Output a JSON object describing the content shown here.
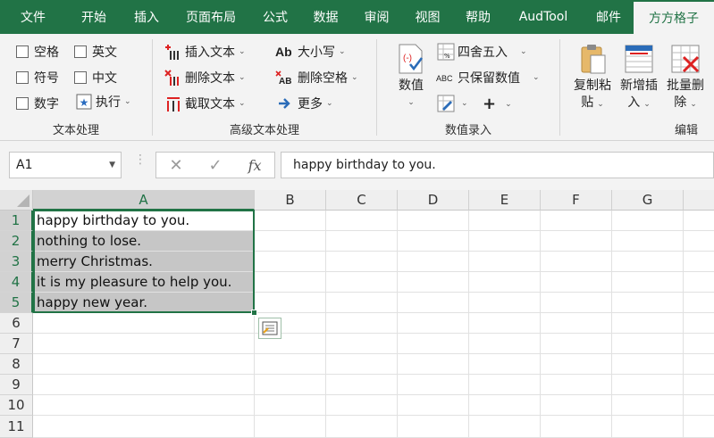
{
  "tabs": [
    "文件",
    "开始",
    "插入",
    "页面布局",
    "公式",
    "数据",
    "审阅",
    "视图",
    "帮助",
    "AudTool",
    "邮件",
    "方方格子"
  ],
  "active_tab": "方方格子",
  "ribbon": {
    "text_processing": {
      "label": "文本处理",
      "checkboxes": [
        "空格",
        "英文",
        "符号",
        "中文",
        "数字"
      ],
      "execute": "执行"
    },
    "advanced_text": {
      "label": "高级文本处理",
      "insert_text": "插入文本",
      "delete_text": "删除文本",
      "extract_text": "截取文本",
      "case": "大小写",
      "delete_spaces": "删除空格",
      "more": "更多"
    },
    "value_entry": {
      "label": "数值录入",
      "value_btn": "数值",
      "round": "四舍五入",
      "keep_values": "只保留数值"
    },
    "edit": {
      "label": "编辑",
      "copy_paste": [
        "复制粘",
        "贴"
      ],
      "add_insert": [
        "新增插",
        "入"
      ],
      "batch_delete": [
        "批量删",
        "除"
      ]
    }
  },
  "formula_bar": {
    "name_box": "A1",
    "content": "happy birthday to you."
  },
  "columns": [
    "A",
    "B",
    "C",
    "D",
    "E",
    "F",
    "G"
  ],
  "rows": [
    "1",
    "2",
    "3",
    "4",
    "5",
    "6",
    "7",
    "8",
    "9",
    "10",
    "11"
  ],
  "cells": [
    "happy birthday to you.",
    "nothing to lose.",
    "merry Christmas.",
    "it is my pleasure to help you.",
    "happy new year."
  ],
  "colors": {
    "excel_green": "#217346",
    "selection_fill": "#c6c6c6"
  }
}
